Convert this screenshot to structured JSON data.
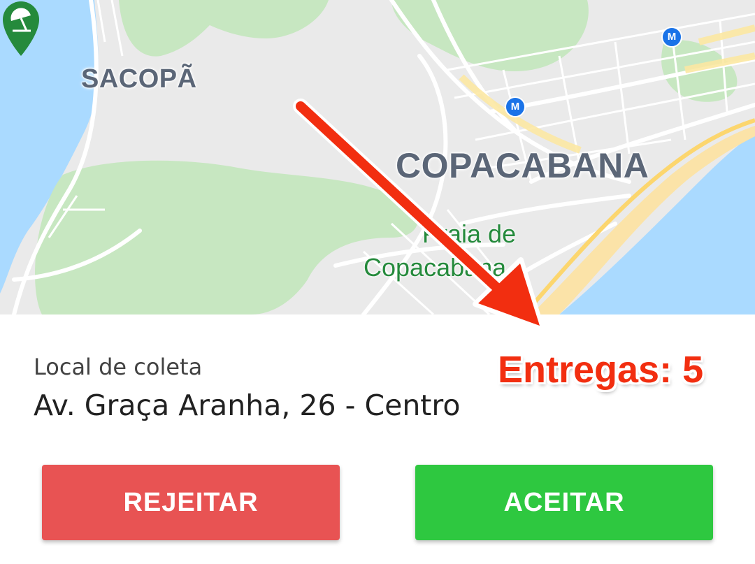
{
  "map": {
    "neighborhoods": {
      "sacopa": "SACOPÃ",
      "copacabana": "COPACABANA"
    },
    "poi": {
      "line1": "Praia de",
      "line2": "Copacabana",
      "icon": "beach-umbrella-pin-icon"
    },
    "metro_icon_label": "M",
    "colors": {
      "water": "#aadaff",
      "park": "#c7e7c1",
      "land": "#eaeaea",
      "beach": "#fbe3a8",
      "poi_green": "#258a3c"
    }
  },
  "annotation": {
    "deliveries": "Entregas: 5",
    "color": "#f22e10"
  },
  "pickup": {
    "label": "Local de coleta",
    "address": "Av. Graça Aranha, 26 - Centro"
  },
  "actions": {
    "reject_label": "REJEITAR",
    "accept_label": "ACEITAR",
    "reject_color": "#e85353",
    "accept_color": "#2ec840"
  }
}
